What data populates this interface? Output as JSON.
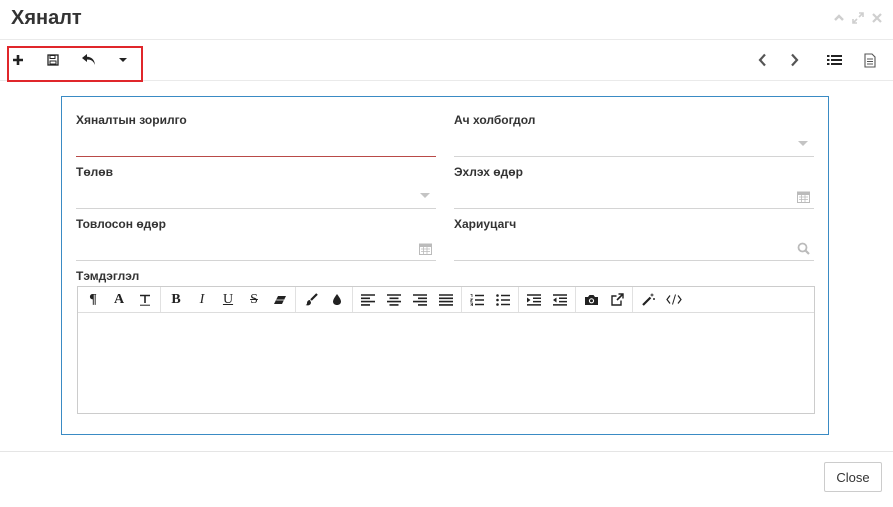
{
  "window": {
    "title": "Хяналт"
  },
  "toolbar": {
    "left_icons": [
      "plus-icon",
      "save-icon",
      "undo-icon",
      "caret-down-icon"
    ],
    "right_icons": [
      "chevron-left-icon",
      "chevron-right-icon",
      "list-icon",
      "document-icon"
    ]
  },
  "form": {
    "fields": [
      {
        "label": "Хяналтын зорилго",
        "value": "",
        "icon": ""
      },
      {
        "label": "Ач холбогдол",
        "value": "",
        "icon": "caret-down-icon"
      },
      {
        "label": "Төлөв",
        "value": "",
        "icon": "caret-down-icon"
      },
      {
        "label": "Эхлэх өдөр",
        "value": "",
        "icon": "calendar-icon"
      },
      {
        "label": "Товлосон өдөр",
        "value": "",
        "icon": "calendar-icon"
      },
      {
        "label": "Хариуцагч",
        "value": "",
        "icon": "search-icon"
      }
    ],
    "notes": {
      "label": "Тэмдэглэл",
      "value": "",
      "toolbar_groups": [
        [
          "paragraph-icon",
          "font-icon",
          "clear-format-icon"
        ],
        [
          "bold-icon",
          "italic-icon",
          "underline-icon",
          "strikethrough-icon",
          "eraser-icon"
        ],
        [
          "brush-icon",
          "color-drop-icon"
        ],
        [
          "align-left-icon",
          "align-center-icon",
          "align-right-icon",
          "align-justify-icon"
        ],
        [
          "ordered-list-icon",
          "unordered-list-icon"
        ],
        [
          "indent-icon",
          "outdent-icon"
        ],
        [
          "camera-icon",
          "external-link-icon"
        ],
        [
          "magic-wand-icon",
          "code-icon"
        ]
      ]
    }
  },
  "footer": {
    "close_label": "Close"
  },
  "colors": {
    "highlight": "#e0262b",
    "panel_border": "#3a8bc4",
    "focused_underline": "#b94a48"
  }
}
